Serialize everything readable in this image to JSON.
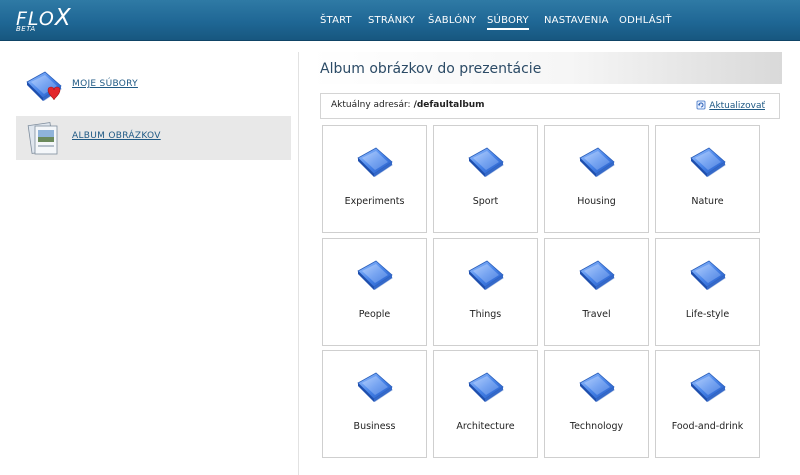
{
  "header": {
    "logo_text": "FLO",
    "logo_x": "X",
    "beta": "BETA",
    "nav": [
      {
        "label": "ŠTART",
        "active": false
      },
      {
        "label": "STRÁNKY",
        "active": false
      },
      {
        "label": "ŠABLÓNY",
        "active": false
      },
      {
        "label": "SÚBORY",
        "active": true
      },
      {
        "label": "NASTAVENIA",
        "active": false
      },
      {
        "label": "ODHLÁSIŤ",
        "active": false
      }
    ]
  },
  "sidebar": {
    "items": [
      {
        "label": "MOJE SÚBORY",
        "icon": "folder-heart-icon",
        "selected": false
      },
      {
        "label": "ALBUM OBRÁZKOV",
        "icon": "photo-album-icon",
        "selected": true
      }
    ]
  },
  "main": {
    "title": "Album obrázkov do prezentácie",
    "address_label": "Aktuálny adresár:",
    "address_path": "/defaultalbum",
    "refresh_label": "Aktualizovať",
    "folders": [
      "Experiments",
      "Sport",
      "Housing",
      "Nature",
      "People",
      "Things",
      "Travel",
      "Life-style",
      "Business",
      "Architecture",
      "Technology",
      "Food-and-drink"
    ]
  },
  "colors": {
    "header": "#1f6795",
    "link": "#205a85",
    "folder_blue": "#3f7ee0"
  }
}
